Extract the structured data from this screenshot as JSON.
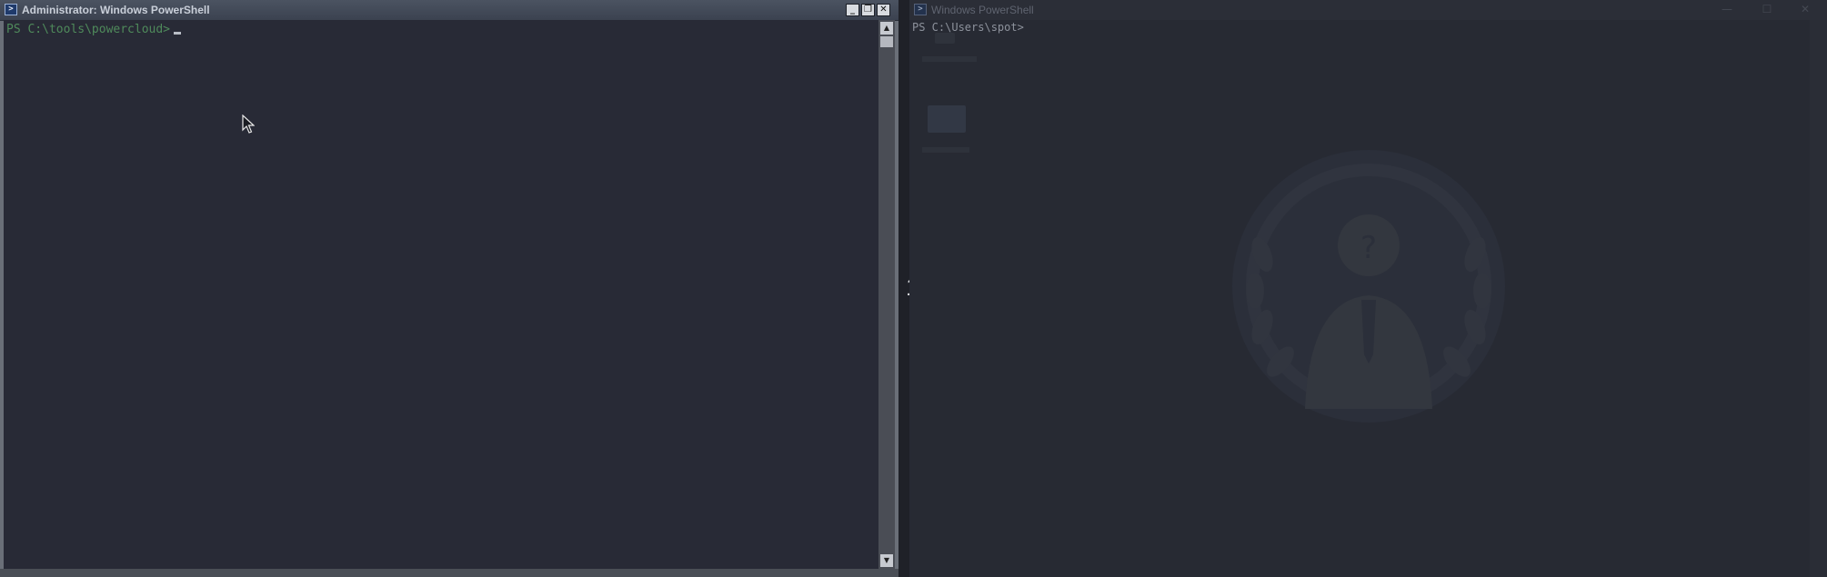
{
  "left_window": {
    "title": "Administrator: Windows PowerShell",
    "icon": "powershell-icon",
    "controls": {
      "minimize": "_",
      "restore": "❐",
      "close": "✕"
    },
    "prompt": "PS C:\\tools\\powercloud>"
  },
  "right_window": {
    "title": "Windows PowerShell",
    "icon": "powershell-icon",
    "controls": {
      "minimize": "—",
      "maximize": "☐",
      "close": "✕"
    },
    "prompt": "PS C:\\Users\\spot>"
  },
  "pane_number": "1",
  "colors": {
    "console_bg": "#282a36",
    "left_prompt": "#4f8a5b",
    "right_prompt": "#8d929c"
  }
}
